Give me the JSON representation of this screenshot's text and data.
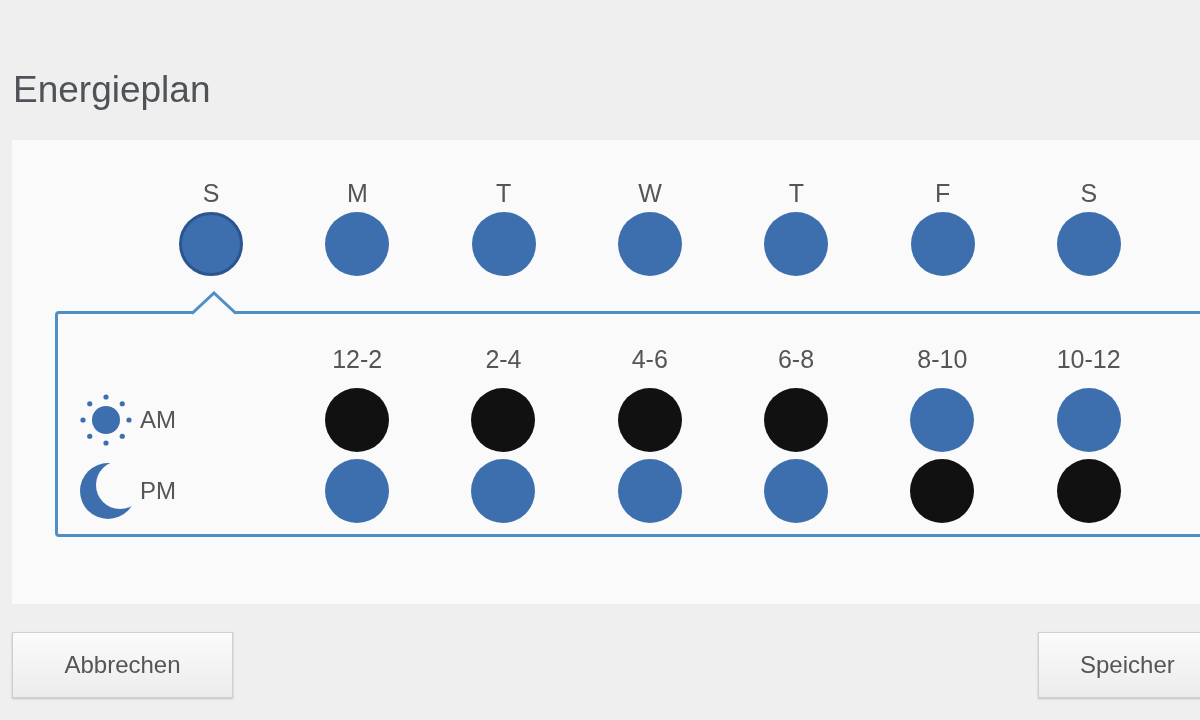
{
  "title": "Energieplan",
  "days": [
    {
      "label": "S",
      "selected": true
    },
    {
      "label": "M",
      "selected": false
    },
    {
      "label": "T",
      "selected": false
    },
    {
      "label": "W",
      "selected": false
    },
    {
      "label": "T",
      "selected": false
    },
    {
      "label": "F",
      "selected": false
    },
    {
      "label": "S",
      "selected": false
    }
  ],
  "periods": [
    {
      "label": "AM",
      "kind": "sun"
    },
    {
      "label": "PM",
      "kind": "moon"
    }
  ],
  "slots": [
    {
      "label": "12-2",
      "am_active": false,
      "pm_active": true
    },
    {
      "label": "2-4",
      "am_active": false,
      "pm_active": true
    },
    {
      "label": "4-6",
      "am_active": false,
      "pm_active": true
    },
    {
      "label": "6-8",
      "am_active": false,
      "pm_active": true
    },
    {
      "label": "8-10",
      "am_active": true,
      "pm_active": false
    },
    {
      "label": "10-12",
      "am_active": true,
      "pm_active": false
    }
  ],
  "buttons": {
    "cancel": "Abbrechen",
    "save": "Speicher"
  }
}
